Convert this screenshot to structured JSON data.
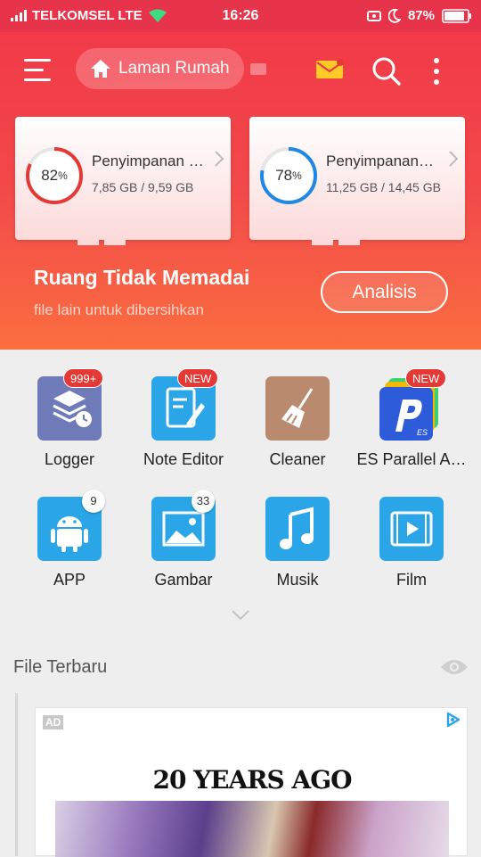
{
  "status_bar": {
    "carrier": "TELKOMSEL LTE",
    "time": "16:26",
    "battery": "87%"
  },
  "toolbar": {
    "home_label": "Laman Rumah",
    "icons": [
      "menu-icon",
      "home-icon",
      "chat-icon",
      "mail-icon",
      "search-icon",
      "more-icon"
    ]
  },
  "storage": [
    {
      "name": "Penyimpanan I…",
      "percent_value": "82",
      "percent_sign": "%",
      "usage": "7,85 GB / 9,59 GB",
      "fill": 0.82,
      "color": "#e53935"
    },
    {
      "name": "Penyimpanan…",
      "percent_value": "78",
      "percent_sign": "%",
      "usage": "11,25 GB / 14,45 GB",
      "fill": 0.78,
      "color": "#1e88e5"
    }
  ],
  "warning": {
    "title": "Ruang Tidak Memadai",
    "subtitle": "file lain untuk dibersihkan",
    "button": "Analisis"
  },
  "apps": [
    {
      "label": "Logger",
      "badge": "999+",
      "icon": "logger-icon"
    },
    {
      "label": "Note Editor",
      "badge": "NEW",
      "icon": "note-editor-icon"
    },
    {
      "label": "Cleaner",
      "badge": "",
      "icon": "broom-icon"
    },
    {
      "label": "ES Parallel A…",
      "badge": "NEW",
      "icon": "es-parallel-icon"
    },
    {
      "label": "APP",
      "count": "9",
      "icon": "android-icon"
    },
    {
      "label": "Gambar",
      "count": "33",
      "icon": "image-icon"
    },
    {
      "label": "Musik",
      "count": "",
      "icon": "music-icon"
    },
    {
      "label": "Film",
      "count": "",
      "icon": "film-icon"
    }
  ],
  "recent": {
    "title": "File Terbaru"
  },
  "ad": {
    "tag": "AD",
    "headline": "20 YEARS AGO"
  },
  "colors": {
    "header_top": "#f23a48",
    "header_bottom": "#fb6e3f",
    "app_blue": "#2aa6e8"
  }
}
